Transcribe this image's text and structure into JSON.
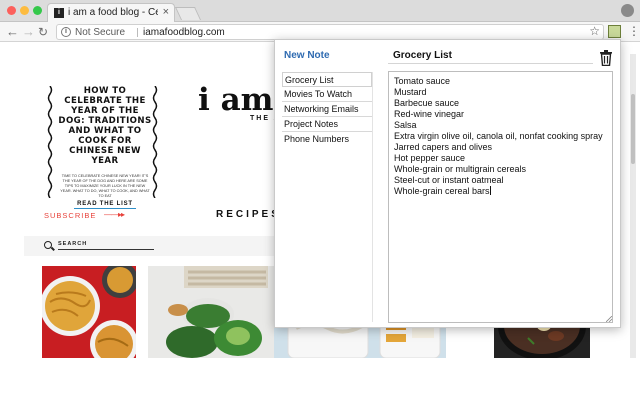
{
  "browser": {
    "tab_title": "i am a food blog - Celebrating",
    "tab_favicon": "i",
    "close_glyph": "×",
    "security_label": "Not Secure",
    "url": "iamafoodblog.com"
  },
  "site": {
    "hero_title": "HOW TO CELEBRATE THE YEAR OF THE DOG: TRADITIONS AND WHAT TO COOK FOR CHINESE NEW YEAR",
    "hero_description": "TIME TO CELEBRATE CHINESE NEW YEAR! IT'S THE YEAR OF THE DOG AND HERE ARE SOME TIPS TO MAXIMIZE YOUR LUCK IN THE NEW YEAR. WHAT TO DO, WHAT TO COOK, AND WHAT TO EAT",
    "read_list_label": "READ THE LIST",
    "subscribe_label": "SUBSCRIBE",
    "subscribe_arrow": "——▸▸",
    "logo_text": "i am a",
    "tagline": "THE A",
    "recipes_label": "RECIPES",
    "search_placeholder": "SEARCH"
  },
  "popup": {
    "new_note_label": "New Note",
    "current_title": "Grocery List",
    "notes": [
      "Grocery List",
      "Movies To Watch",
      "Networking Emails",
      "Project Notes",
      "Phone Numbers"
    ],
    "body_lines": [
      "Tomato sauce",
      "Mustard",
      "Barbecue sauce",
      "Red-wine vinegar",
      "Salsa",
      "Extra virgin olive oil, canola oil, nonfat cooking spray",
      "Jarred capers and olives",
      "Hot pepper sauce",
      "Whole-grain or multigrain cereals",
      "Steel-cut or instant oatmeal",
      "Whole-grain cereal bars"
    ]
  },
  "colors": {
    "accent_blue": "#2f6bb1",
    "subscribe_red": "#e8423b",
    "read_underline": "#2f8fc8"
  },
  "icons": [
    "back-arrow-icon",
    "forward-arrow-icon",
    "reload-icon",
    "info-icon",
    "star-icon",
    "extension-icon",
    "menu-icon",
    "trash-icon",
    "search-icon",
    "profile-icon"
  ]
}
